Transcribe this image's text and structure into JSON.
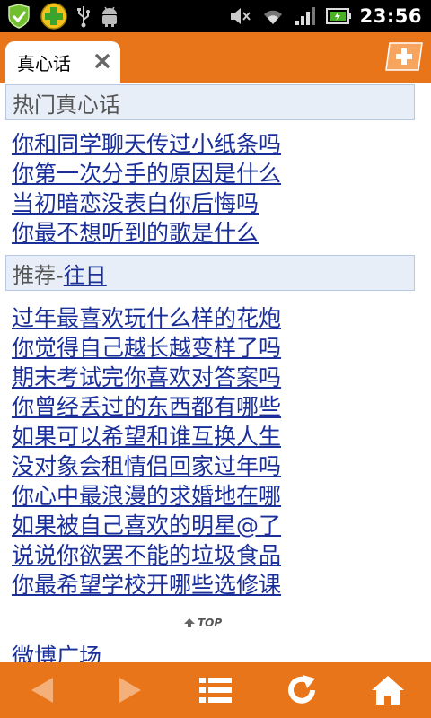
{
  "status_bar": {
    "time": "23:56",
    "icons": [
      "shield-check-icon",
      "plus-cross-icon",
      "usb-icon",
      "android-debug-icon",
      "mute-icon",
      "wifi-icon",
      "signal-icon",
      "battery-icon"
    ]
  },
  "browser": {
    "tab_label": "真心话",
    "new_tab_icon": "add-tab-icon"
  },
  "sections": {
    "hot": {
      "title": "热门真心话",
      "items": [
        "你和同学聊天传过小纸条吗",
        "你第一次分手的原因是什么",
        "当初暗恋没表白你后悔吗",
        "你最不想听到的歌是什么"
      ]
    },
    "recommended": {
      "title_prefix": "推荐-",
      "title_link": "往日",
      "items": [
        "过年最喜欢玩什么样的花炮",
        "你觉得自己越长越变样了吗",
        "期末考试完你喜欢对答案吗",
        "你曾经丢过的东西都有哪些",
        "如果可以希望和谁互换人生",
        "没对象会租情侣回家过年吗",
        "你心中最浪漫的求婚地在哪",
        "如果被自己喜欢的明星@了",
        "说说你欲罢不能的垃圾食品",
        "你最希望学校开哪些选修课"
      ]
    }
  },
  "top_link": "TOP",
  "weibo_link": "微博广场",
  "toolbar": {
    "buttons": [
      "back-icon",
      "forward-icon",
      "menu-list-icon",
      "refresh-icon",
      "home-icon"
    ]
  },
  "colors": {
    "accent": "#e8751a",
    "link": "#1a2f99",
    "header_bg": "#e8eef8"
  }
}
